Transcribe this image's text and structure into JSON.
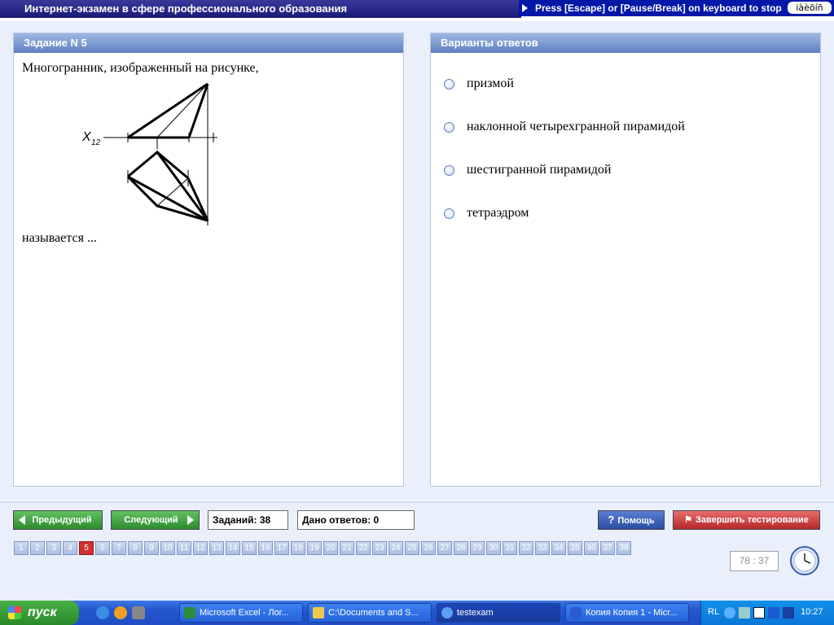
{
  "window": {
    "title": "Интернет-экзамен в сфере профессионального образования",
    "escape_hint": "Press [Escape] or [Pause/Break] on keyboard to stop",
    "keyboard_indicator": "iàèõíñ"
  },
  "task": {
    "header": "Задание N 5",
    "question_main": "Многогранник, изображенный на рисунке,",
    "question_suffix": "называется ...",
    "figure_axis_label": "X",
    "figure_axis_subscript": "12"
  },
  "answers": {
    "header": "Варианты ответов",
    "options": [
      "призмой",
      "наклонной четырехгранной пирамидой",
      "шестигранной пирамидой",
      "тетраэдром"
    ]
  },
  "toolbar": {
    "prev_label": "Предыдущий",
    "next_label": "Следующий",
    "tasks_count": "Заданий: 38",
    "answers_given": "Дано ответов: 0",
    "help_label": "Помощь",
    "finish_label": "Завершить тестирование"
  },
  "pages": {
    "items": [
      "1",
      "2",
      "3",
      "4",
      "5",
      "6",
      "7",
      "8",
      "9",
      "10",
      "11",
      "12",
      "13",
      "14",
      "15",
      "16",
      "17",
      "18",
      "19",
      "20",
      "21",
      "22",
      "23",
      "24",
      "25",
      "26",
      "27",
      "28",
      "29",
      "30",
      "31",
      "32",
      "33",
      "34",
      "35",
      "36",
      "37",
      "38"
    ],
    "active": "5"
  },
  "timer": {
    "value": "78 : 37"
  },
  "taskbar": {
    "start_label": "пуск",
    "tasks": [
      "Microsoft Excel - Лог...",
      "C:\\Documents and S...",
      "testexam",
      "Копия Копия 1 - Micr..."
    ],
    "active_task": "testexam",
    "tray_lang": "RL",
    "clock": "10:27"
  },
  "icons": {
    "help": "question-icon",
    "finish": "running-man-icon",
    "clock": "clock-icon"
  }
}
